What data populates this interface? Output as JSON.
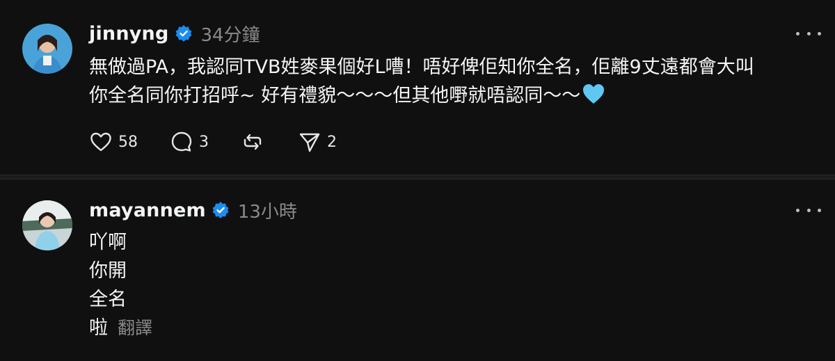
{
  "posts": [
    {
      "username": "jinnyng",
      "time": "34分鐘",
      "lines": [
        "無做過PA，我認同TVB姓麥果個好L嘈！唔好俾佢知你全名，佢離9丈遠都會大叫",
        "你全名同你打招呼~ 好有禮貌～～～但其他嘢就唔認同～～"
      ],
      "emoji": "light-blue-heart",
      "actions": {
        "likes": "58",
        "replies": "3",
        "shares": "2"
      }
    },
    {
      "username": "mayannem",
      "time": "13小時",
      "lines": [
        "吖啊",
        "你開",
        "全名",
        "啦"
      ],
      "translate_label": "翻譯"
    }
  ],
  "colors": {
    "background": "#101010",
    "verified": "#1d8cf0",
    "secondary_text": "#8a8a8a",
    "heart_emoji": "#5ec8f2"
  }
}
